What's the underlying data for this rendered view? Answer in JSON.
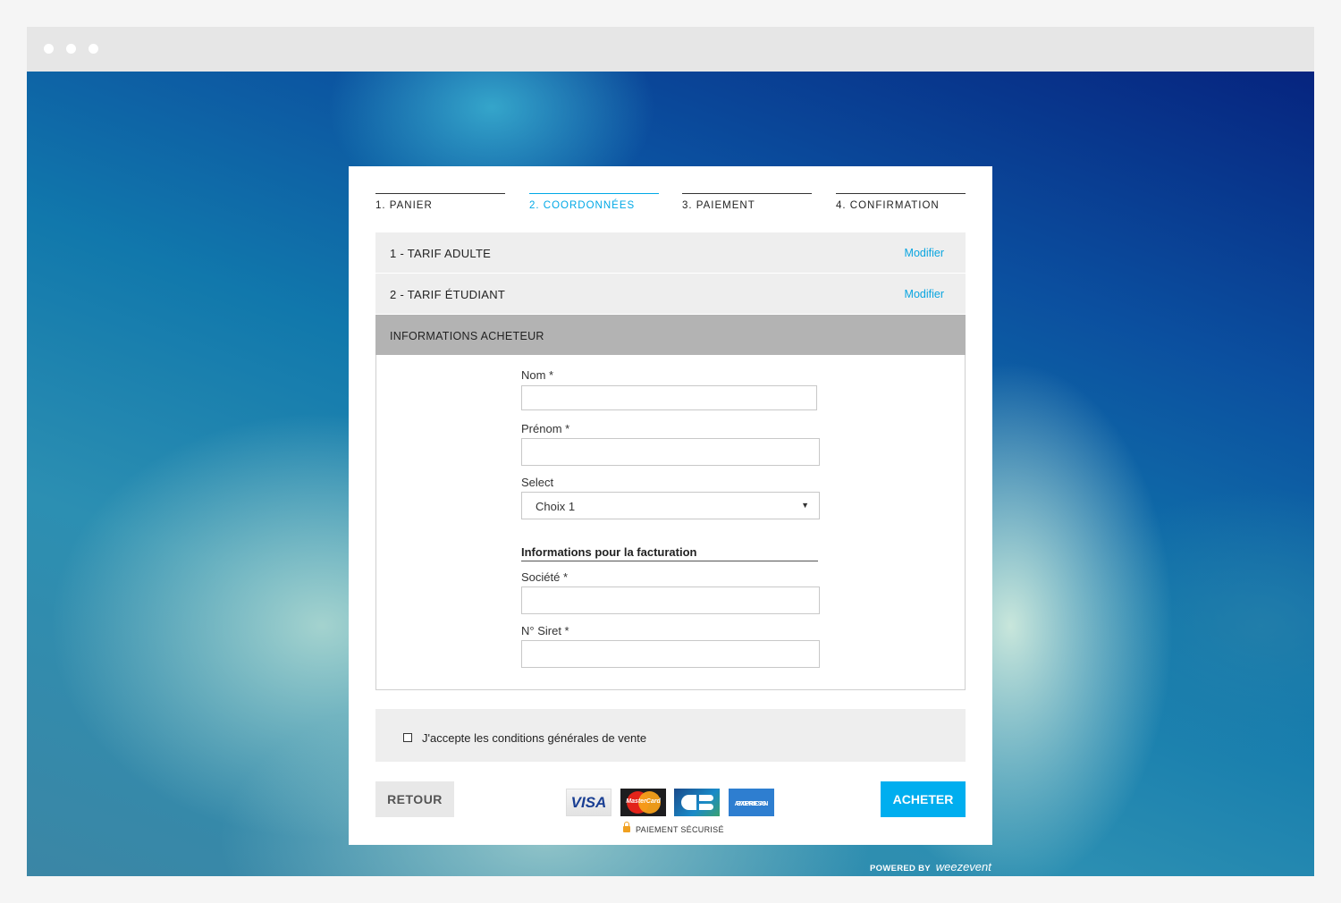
{
  "steps": [
    {
      "label": "1. PANIER"
    },
    {
      "label": "2. COORDONNÉES"
    },
    {
      "label": "3. PAIEMENT"
    },
    {
      "label": "4. CONFIRMATION"
    }
  ],
  "tarifs": [
    {
      "label": "1 - TARIF ADULTE",
      "action": "Modifier"
    },
    {
      "label": "2 - TARIF ÉTUDIANT",
      "action": "Modifier"
    }
  ],
  "buyer_info": {
    "heading": "INFORMATIONS ACHETEUR",
    "nom_label": "Nom *",
    "nom_value": "",
    "prenom_label": "Prénom *",
    "prenom_value": "",
    "select_label": "Select",
    "select_value": "Choix 1",
    "select_arrow": "▼",
    "billing_title": "Informations pour la facturation",
    "societe_label": "Société *",
    "societe_value": "",
    "siret_label": "N° Siret *",
    "siret_value": ""
  },
  "cgv": {
    "label": "J'accepte les conditions générales de vente",
    "checked": false
  },
  "footer": {
    "back_label": "RETOUR",
    "buy_label": "ACHETER",
    "secure_label": "PAIEMENT SÉCURISÉ",
    "cards": {
      "visa": "VISA",
      "mastercard": "MasterCard",
      "amex_line1": "AMERICAN",
      "amex_line2": "EXPRESS"
    }
  },
  "powered_by": {
    "prefix": "POWERED BY",
    "brand": "weezevent"
  },
  "colors": {
    "accent": "#00aeef",
    "link": "#0aa5e0",
    "section_header": "#b3b3b3",
    "panel": "#eeeeee"
  }
}
